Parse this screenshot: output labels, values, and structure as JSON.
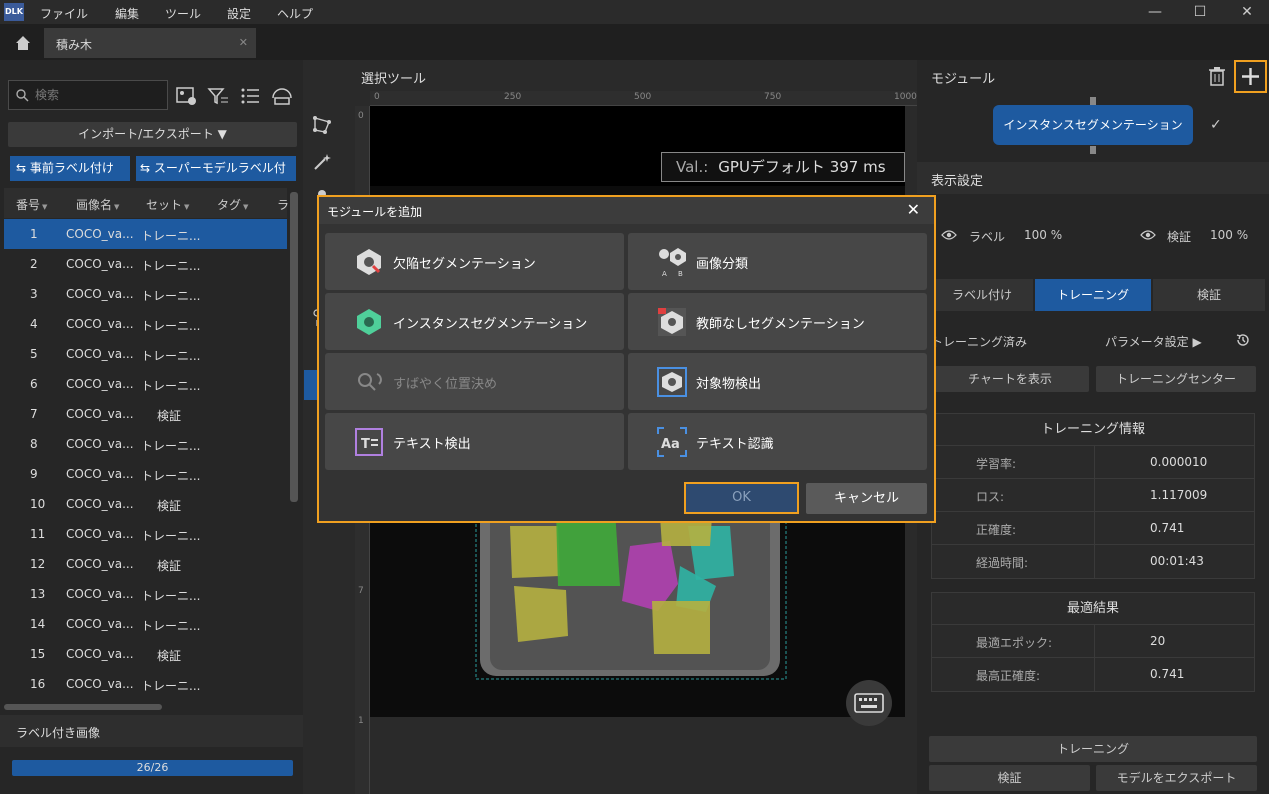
{
  "menu": [
    "ファイル",
    "編集",
    "ツール",
    "設定",
    "ヘルプ"
  ],
  "tab": {
    "label": "積み木"
  },
  "left": {
    "search_placeholder": "検索",
    "import_label": "インポート/エクスポート ▼",
    "prelabel_label": "事前ラベル付け",
    "supermodel_label": "スーパーモデルラベル付",
    "columns": [
      "番号",
      "画像名",
      "セット",
      "タグ",
      "ラ"
    ],
    "rows": [
      {
        "no": "1",
        "name": "COCO_va...",
        "set": "トレーニ..."
      },
      {
        "no": "2",
        "name": "COCO_va...",
        "set": "トレーニ..."
      },
      {
        "no": "3",
        "name": "COCO_va...",
        "set": "トレーニ..."
      },
      {
        "no": "4",
        "name": "COCO_va...",
        "set": "トレーニ..."
      },
      {
        "no": "5",
        "name": "COCO_va...",
        "set": "トレーニ..."
      },
      {
        "no": "6",
        "name": "COCO_va...",
        "set": "トレーニ..."
      },
      {
        "no": "7",
        "name": "COCO_va...",
        "set": "検証"
      },
      {
        "no": "8",
        "name": "COCO_va...",
        "set": "トレーニ..."
      },
      {
        "no": "9",
        "name": "COCO_va...",
        "set": "トレーニ..."
      },
      {
        "no": "10",
        "name": "COCO_va...",
        "set": "検証"
      },
      {
        "no": "11",
        "name": "COCO_va...",
        "set": "トレーニ..."
      },
      {
        "no": "12",
        "name": "COCO_va...",
        "set": "検証"
      },
      {
        "no": "13",
        "name": "COCO_va...",
        "set": "トレーニ..."
      },
      {
        "no": "14",
        "name": "COCO_va...",
        "set": "トレーニ..."
      },
      {
        "no": "15",
        "name": "COCO_va...",
        "set": "検証"
      },
      {
        "no": "16",
        "name": "COCO_va...",
        "set": "トレーニ..."
      }
    ],
    "labeled_title": "ラベル付き画像",
    "progress": "26/26",
    "progress_fraction": 1.0
  },
  "center": {
    "title": "選択ツール",
    "ruler_h": [
      "0",
      "250",
      "500",
      "750",
      "1000"
    ],
    "ruler_v": [
      "0",
      "7",
      "1"
    ],
    "val_label": "Val.:",
    "val_text": "GPUデフォルト 397 ms"
  },
  "right": {
    "module_title": "モジュール",
    "module_node": "インスタンスセグメンテーション",
    "check": "✓",
    "display_title": "表示設定",
    "label_vis": "ラベル",
    "label_pct": "100 %",
    "verify_vis": "検証",
    "verify_pct": "100 %",
    "tabs": [
      "ラベル付け",
      "トレーニング",
      "検証"
    ],
    "trained": "トレーニング済み",
    "params": "パラメータ設定 ▶",
    "chart_btn": "チャートを表示",
    "center_btn": "トレーニングセンター",
    "train_info_title": "トレーニング情報",
    "train_info": [
      {
        "k": "学習率:",
        "v": "0.000010"
      },
      {
        "k": "ロス:",
        "v": "1.117009"
      },
      {
        "k": "正確度:",
        "v": "0.741"
      },
      {
        "k": "経過時間:",
        "v": "00:01:43"
      }
    ],
    "best_title": "最適結果",
    "best": [
      {
        "k": "最適エポック:",
        "v": "20"
      },
      {
        "k": "最高正確度:",
        "v": "0.741"
      }
    ],
    "train_btn": "トレーニング",
    "verify_btn": "検証",
    "export_btn": "モデルをエクスポート"
  },
  "modal": {
    "title": "モジュールを追加",
    "close": "✕",
    "items": [
      "欠陥セグメンテーション",
      "画像分類",
      "インスタンスセグメンテーション",
      "教師なしセグメンテーション",
      "すばやく位置決め",
      "対象物検出",
      "テキスト検出",
      "テキスト認識"
    ],
    "ok": "OK",
    "cancel": "キャンセル"
  },
  "colors": {
    "accent_blue": "#1e5aa0",
    "highlight_orange": "#f0a020"
  }
}
